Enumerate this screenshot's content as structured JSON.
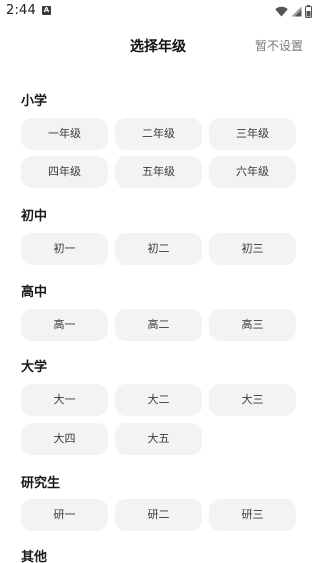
{
  "status_bar": {
    "time": "2:44",
    "notification_icon_letter": "A",
    "icons": [
      "wifi-icon",
      "signal-icon",
      "battery-icon"
    ]
  },
  "header": {
    "title": "选择年级",
    "skip_label": "暂不设置"
  },
  "sections": [
    {
      "title": "小学",
      "options": [
        "一年级",
        "二年级",
        "三年级",
        "四年级",
        "五年级",
        "六年级"
      ]
    },
    {
      "title": "初中",
      "options": [
        "初一",
        "初二",
        "初三"
      ]
    },
    {
      "title": "高中",
      "options": [
        "高一",
        "高二",
        "高三"
      ]
    },
    {
      "title": "大学",
      "options": [
        "大一",
        "大二",
        "大三",
        "大四",
        "大五"
      ]
    },
    {
      "title": "研究生",
      "options": [
        "研一",
        "研二",
        "研三"
      ]
    },
    {
      "title": "其他",
      "options": []
    }
  ],
  "colors": {
    "chip_background": "#f3f3f3",
    "chip_text": "#3a3a3a",
    "skip_text": "#7a7a7a"
  }
}
